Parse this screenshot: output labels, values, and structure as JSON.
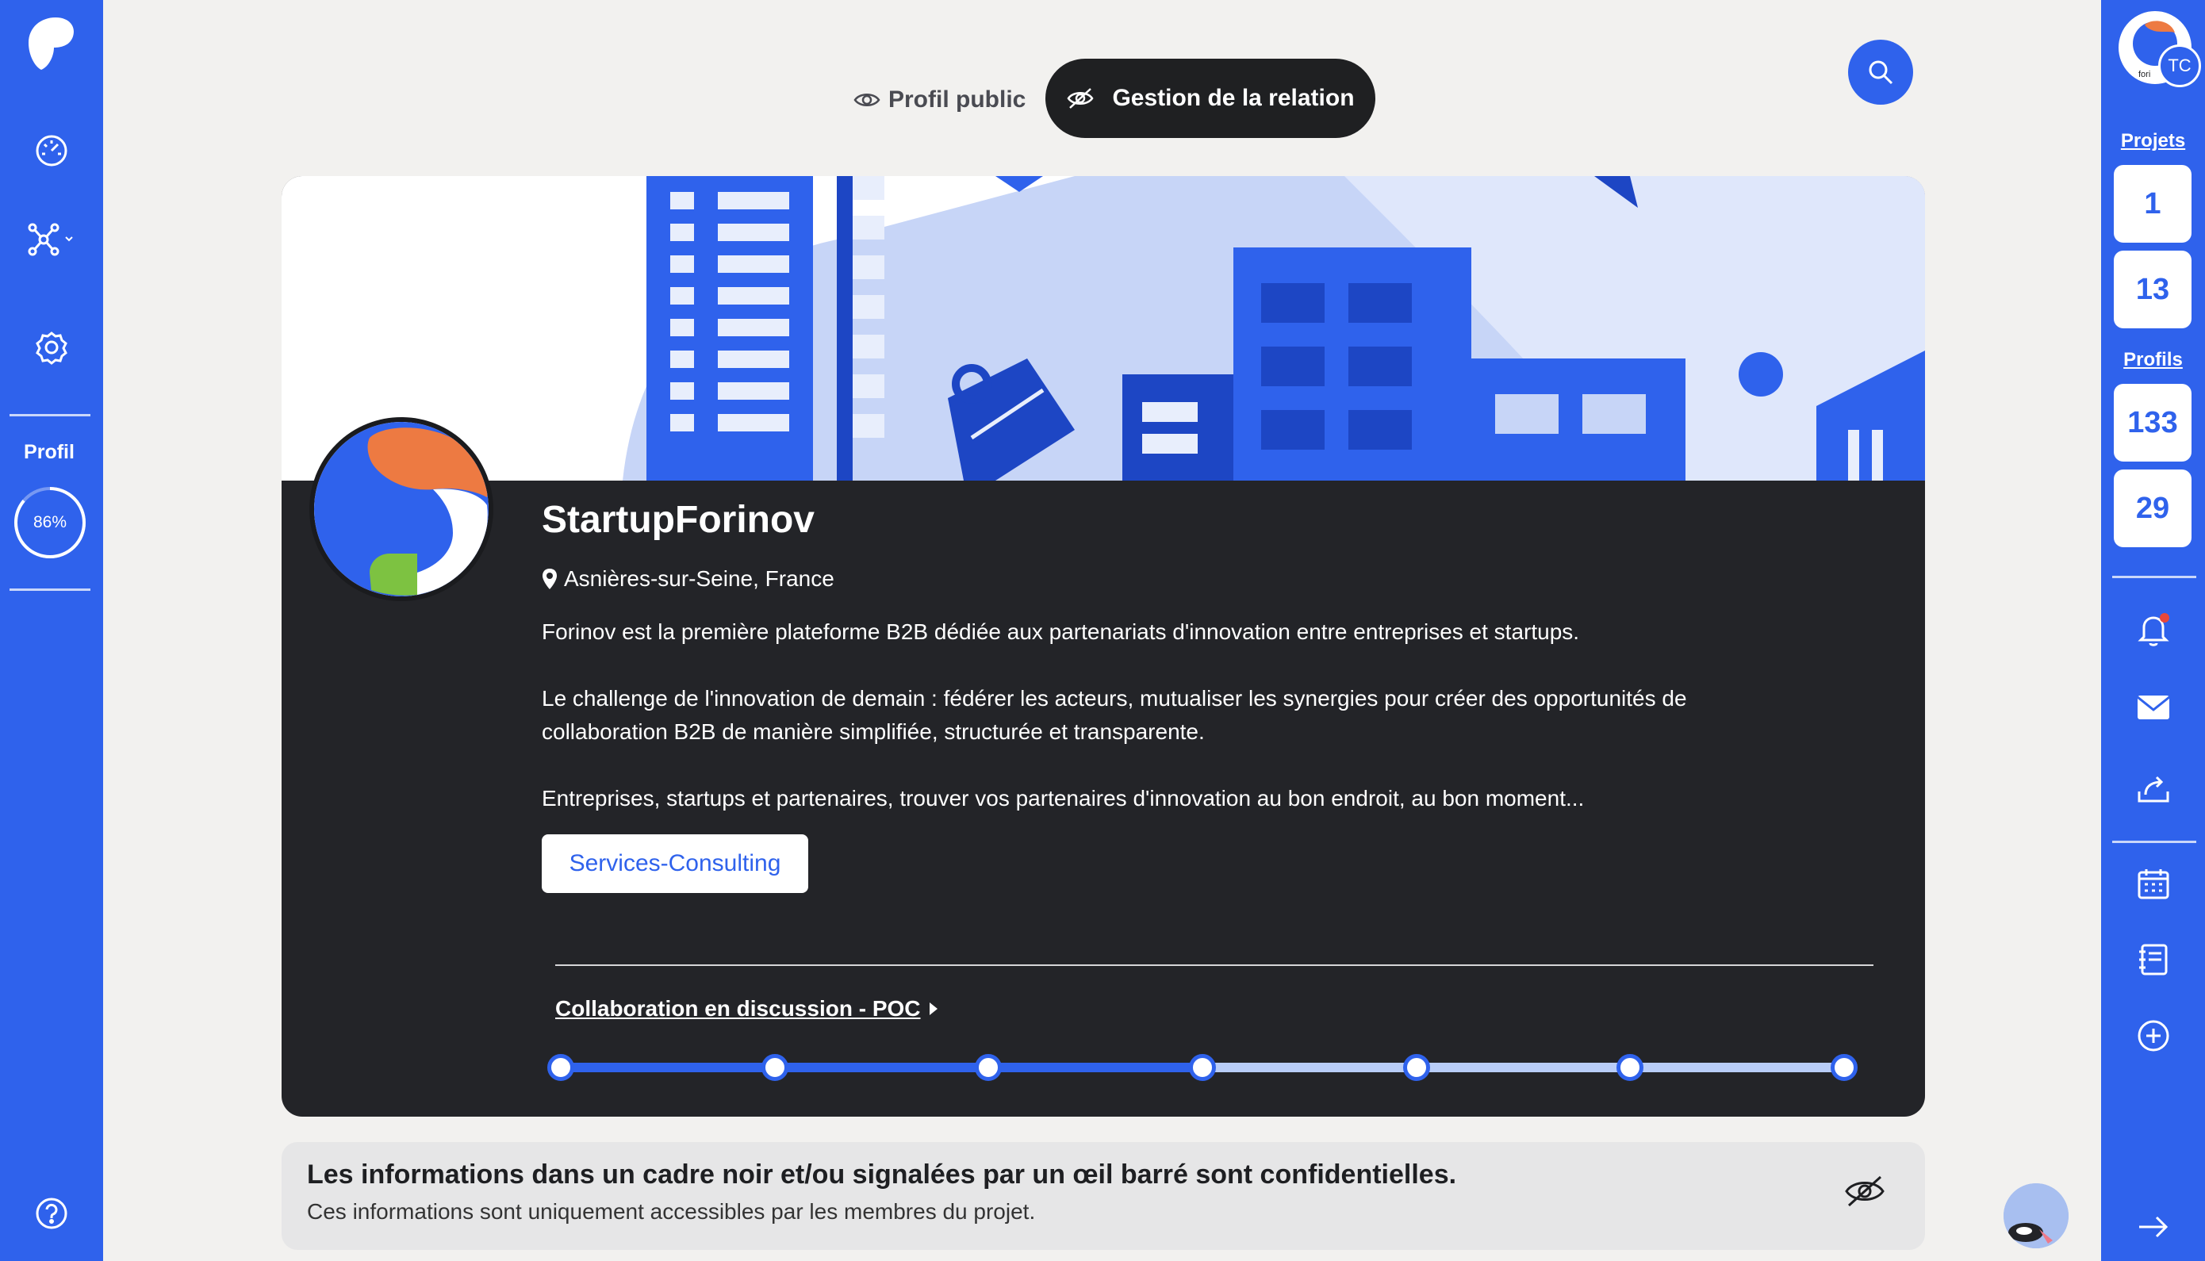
{
  "left_sidebar": {
    "profile_label": "Profil",
    "profile_progress_text": "86%",
    "profile_progress_value": 0.86
  },
  "top_toggle": {
    "public_label": "Profil public",
    "gestion_label": "Gestion de la relation"
  },
  "company": {
    "name": "StartupForinov",
    "location": "Asnières-sur-Seine, France",
    "description_1": "Forinov est la première plateforme B2B dédiée aux partenariats d'innovation entre entreprises et startups.",
    "description_2_line1": "Le challenge de l'innovation de demain : fédérer les acteurs, mutualiser les synergies pour créer des opportunités de",
    "description_2_line2": "collaboration B2B de manière simplifiée, structurée et transparente.",
    "description_3": "Entreprises, startups et partenaires, trouver vos partenaires d'innovation au bon endroit, au bon moment...",
    "tag": "Services-Consulting"
  },
  "collaboration": {
    "link_label": "Collaboration en discussion - POC",
    "steps_total": 7,
    "steps_completed": 4
  },
  "info": {
    "title": "Les informations dans un cadre noir et/ou signalées par un œil barré sont confidentielles.",
    "subtitle": "Ces informations sont uniquement accessibles par les membres du projet."
  },
  "right_sidebar": {
    "avatar_initials": "TC",
    "projets_label": "Projets",
    "projets_counts": [
      "1",
      "13"
    ],
    "profils_label": "Profils",
    "profils_counts": [
      "133",
      "29"
    ]
  },
  "colors": {
    "brand_blue": "#2f62ec",
    "dark_card": "#232428",
    "light_progress": "#b9cdf8"
  }
}
